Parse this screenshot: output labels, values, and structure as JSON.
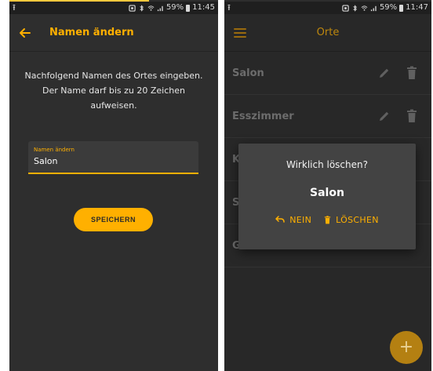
{
  "colors": {
    "accent": "#ffb000",
    "background": "#2e2e2e",
    "statusbar": "#1f1f1f",
    "dialog": "#434343"
  },
  "left_screen": {
    "statusbar": {
      "upload_icon": "upload-arrow-icon",
      "battery": "59%",
      "time": "11:45"
    },
    "appbar": {
      "back_icon": "arrow-left-icon",
      "title": "Namen ändern"
    },
    "instructions": "Nachfolgend Namen des Ortes eingeben. Der Name darf bis zu 20 Zeichen aufweisen.",
    "field": {
      "label": "Namen ändern",
      "value": "Salon"
    },
    "save_button": "SPEICHERN"
  },
  "right_screen": {
    "statusbar": {
      "upload_icon": "upload-arrow-icon",
      "battery": "59%",
      "time": "11:47"
    },
    "appbar": {
      "menu_icon": "hamburger-menu-icon",
      "title": "Orte"
    },
    "list": [
      {
        "label": "Salon"
      },
      {
        "label": "Esszimmer"
      },
      {
        "label": "K"
      },
      {
        "label": "S"
      },
      {
        "label": "G"
      }
    ],
    "dialog": {
      "question": "Wirklich löschen?",
      "name": "Salon",
      "no_label": "NEIN",
      "delete_label": "LÖSCHEN"
    },
    "fab_icon": "plus-icon",
    "fab_label": "+"
  }
}
